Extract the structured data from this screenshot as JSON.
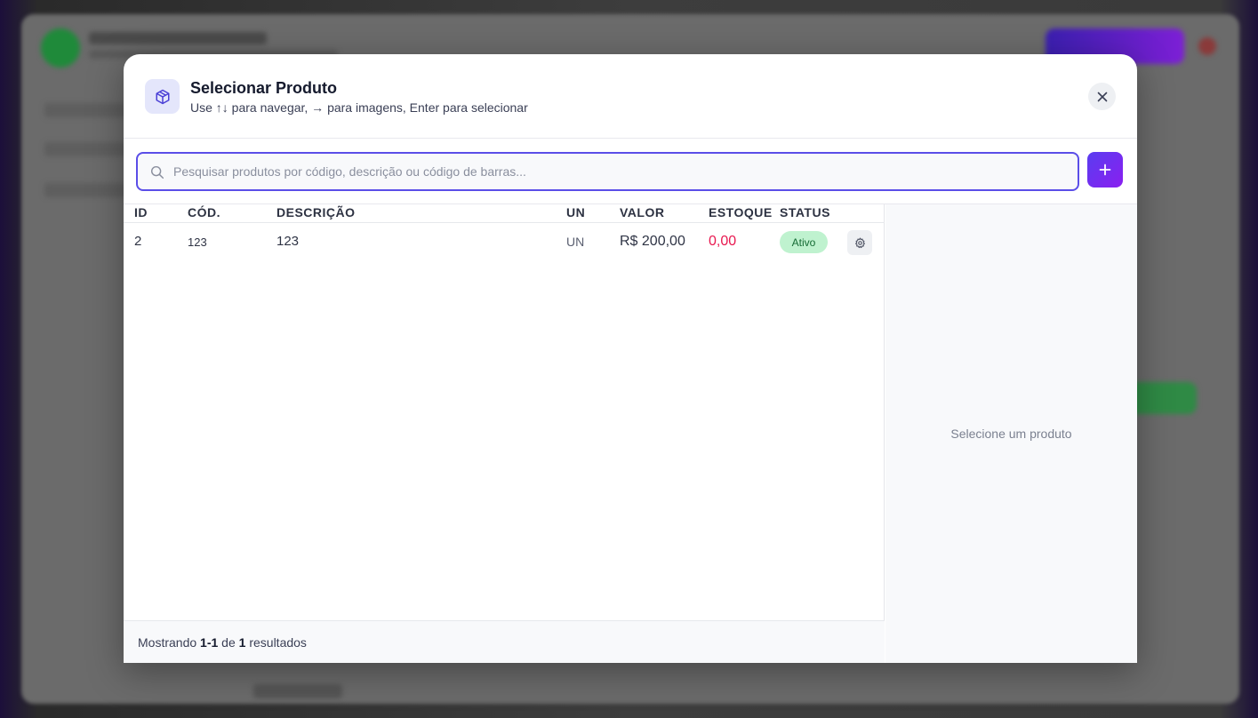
{
  "modal": {
    "title": "Selecionar Produto",
    "subtitle": "Use ↑↓ para navegar, → para imagens, Enter para selecionar",
    "icon": "package-icon",
    "close_icon": "close-icon"
  },
  "search": {
    "placeholder": "Pesquisar produtos por código, descrição ou código de barras...",
    "value": "",
    "add_icon": "plus-icon",
    "add_label": "+"
  },
  "table": {
    "columns": [
      "ID",
      "CÓD.",
      "DESCRIÇÃO",
      "UN",
      "VALOR",
      "ESTOQUE",
      "STATUS"
    ],
    "rows": [
      {
        "id": "2",
        "code": "123",
        "description": "123",
        "unit": "UN",
        "price": "R$ 200,00",
        "stock": "0,00",
        "status": "Ativo",
        "action_icon": "gear-icon"
      }
    ]
  },
  "footer": {
    "prefix": "Mostrando",
    "range": "1-1",
    "of": "de",
    "total": "1",
    "suffix": "resultados"
  },
  "preview": {
    "empty_text": "Selecione um produto"
  },
  "colors": {
    "accent": "#5b4ee8",
    "stock_negative": "#e8184f",
    "status_active_bg": "#bff2cf",
    "status_active_text": "#146b34"
  }
}
